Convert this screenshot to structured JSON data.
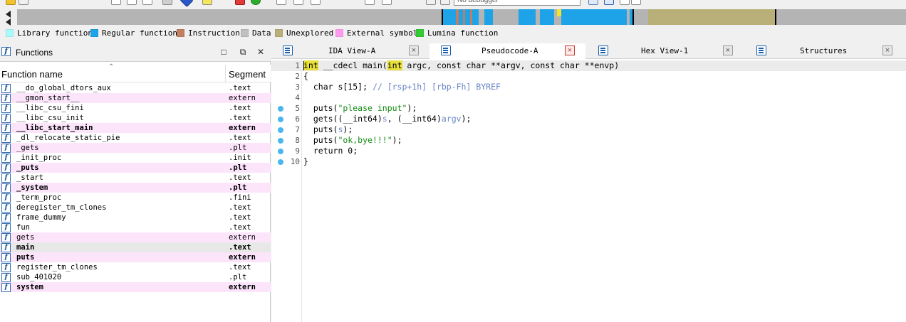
{
  "toolbar": {
    "debugger_value": "No debugger"
  },
  "legend": [
    {
      "label": "Library function",
      "color": "#a9fbfb"
    },
    {
      "label": "Regular function",
      "color": "#1ea3e8"
    },
    {
      "label": "Instruction",
      "color": "#c08060"
    },
    {
      "label": "Data",
      "color": "#c0c0c0"
    },
    {
      "label": "Unexplored",
      "color": "#b8b078"
    },
    {
      "label": "External symbol",
      "color": "#ff9cf0"
    },
    {
      "label": "Lumina function",
      "color": "#33cc33"
    }
  ],
  "functions_panel": {
    "title": "Functions",
    "col_name": "Function name",
    "col_segment": "Segment",
    "rows": [
      {
        "name": "__do_global_dtors_aux",
        "segment": ".text",
        "style": "plain"
      },
      {
        "name": "__gmon_start__",
        "segment": "extern",
        "style": "pink"
      },
      {
        "name": "__libc_csu_fini",
        "segment": ".text",
        "style": "plain"
      },
      {
        "name": "__libc_csu_init",
        "segment": ".text",
        "style": "plain"
      },
      {
        "name": "__libc_start_main",
        "segment": "extern",
        "style": "pink-bold"
      },
      {
        "name": "_dl_relocate_static_pie",
        "segment": ".text",
        "style": "plain"
      },
      {
        "name": "_gets",
        "segment": ".plt",
        "style": "pink"
      },
      {
        "name": "_init_proc",
        "segment": ".init",
        "style": "plain"
      },
      {
        "name": "_puts",
        "segment": ".plt",
        "style": "pink-bold"
      },
      {
        "name": "_start",
        "segment": ".text",
        "style": "plain"
      },
      {
        "name": "_system",
        "segment": ".plt",
        "style": "pink-bold"
      },
      {
        "name": "_term_proc",
        "segment": ".fini",
        "style": "plain"
      },
      {
        "name": "deregister_tm_clones",
        "segment": ".text",
        "style": "plain"
      },
      {
        "name": "frame_dummy",
        "segment": ".text",
        "style": "plain"
      },
      {
        "name": "fun",
        "segment": ".text",
        "style": "plain"
      },
      {
        "name": "gets",
        "segment": "extern",
        "style": "pink"
      },
      {
        "name": "main",
        "segment": ".text",
        "style": "sel-bold"
      },
      {
        "name": "puts",
        "segment": "extern",
        "style": "pink-bold"
      },
      {
        "name": "register_tm_clones",
        "segment": ".text",
        "style": "plain"
      },
      {
        "name": "sub_401020",
        "segment": ".plt",
        "style": "plain"
      },
      {
        "name": "system",
        "segment": "extern",
        "style": "pink-bold"
      }
    ]
  },
  "tabs": [
    {
      "label": "IDA View-A",
      "active": false
    },
    {
      "label": "Pseudocode-A",
      "active": true
    },
    {
      "label": "Hex View-1",
      "active": false
    },
    {
      "label": "Structures",
      "active": false
    }
  ],
  "code": {
    "lines": [
      {
        "num": "1",
        "bp": false,
        "parts": [
          [
            "int",
            "hl"
          ],
          [
            " __cdecl main(",
            "n"
          ],
          [
            "int",
            "hl"
          ],
          [
            " argc, const char **argv, const char **envp)",
            "n"
          ]
        ]
      },
      {
        "num": "2",
        "bp": false,
        "parts": [
          [
            "{",
            "n"
          ]
        ]
      },
      {
        "num": "3",
        "bp": false,
        "parts": [
          [
            "  char s[15]; ",
            "n"
          ],
          [
            "// [rsp+1h] [rbp-Fh] BYREF",
            "cmt"
          ]
        ]
      },
      {
        "num": "4",
        "bp": false,
        "parts": []
      },
      {
        "num": "5",
        "bp": true,
        "parts": [
          [
            "  puts(",
            "n"
          ],
          [
            "\"please input\"",
            "str"
          ],
          [
            ");",
            "n"
          ]
        ]
      },
      {
        "num": "6",
        "bp": true,
        "parts": [
          [
            "  gets((__int64)",
            "n"
          ],
          [
            "s",
            "var"
          ],
          [
            ", (__int64)",
            "n"
          ],
          [
            "argv",
            "var"
          ],
          [
            ");",
            "n"
          ]
        ]
      },
      {
        "num": "7",
        "bp": true,
        "parts": [
          [
            "  puts(",
            "n"
          ],
          [
            "s",
            "var"
          ],
          [
            ");",
            "n"
          ]
        ]
      },
      {
        "num": "8",
        "bp": true,
        "parts": [
          [
            "  puts(",
            "n"
          ],
          [
            "\"ok,bye!!!\"",
            "str"
          ],
          [
            ");",
            "n"
          ]
        ]
      },
      {
        "num": "9",
        "bp": true,
        "parts": [
          [
            "  return 0;",
            "n"
          ]
        ]
      },
      {
        "num": "10",
        "bp": true,
        "parts": [
          [
            "}",
            "n"
          ]
        ]
      }
    ]
  }
}
